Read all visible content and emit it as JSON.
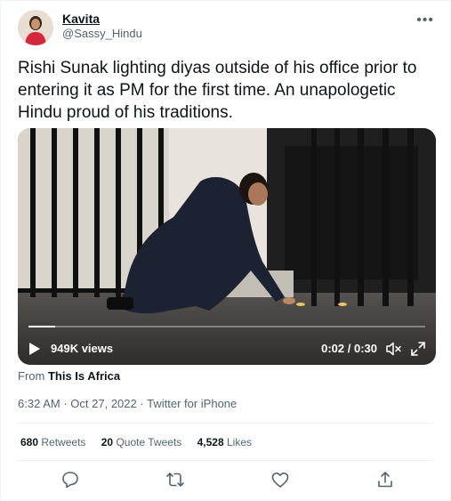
{
  "author": {
    "name": "Kavita",
    "handle": "@Sassy_Hindu",
    "avatar_icon": "profile-photo"
  },
  "more_icon": "more-horizontal-icon",
  "tweet": {
    "text": "Rishi Sunak lighting diyas outside of his office prior to entering it as PM for the first time. An unapologetic Hindu proud of his traditions."
  },
  "video": {
    "views": "949K views",
    "time": "0:02 / 0:30",
    "progress": 0.067,
    "play_icon": "play-icon",
    "mute_icon": "volume-muted-icon",
    "fullscreen_icon": "fullscreen-icon"
  },
  "source": {
    "prefix": "From",
    "name": "This Is Africa"
  },
  "meta": {
    "time": "6:32 AM",
    "separator1": "·",
    "date": "Oct 27, 2022",
    "separator2": "·",
    "client": "Twitter for iPhone"
  },
  "stats": {
    "retweets_count": "680",
    "retweets_label": "Retweets",
    "quotes_count": "20",
    "quotes_label": "Quote Tweets",
    "likes_count": "4,528",
    "likes_label": "Likes"
  },
  "actions": [
    "reply-icon",
    "retweet-icon",
    "like-icon",
    "share-icon"
  ],
  "colors": {
    "text_primary": "#0f1419",
    "text_secondary": "#536471",
    "divider": "#eff3f4",
    "avatar_dress": "#d6263a"
  }
}
